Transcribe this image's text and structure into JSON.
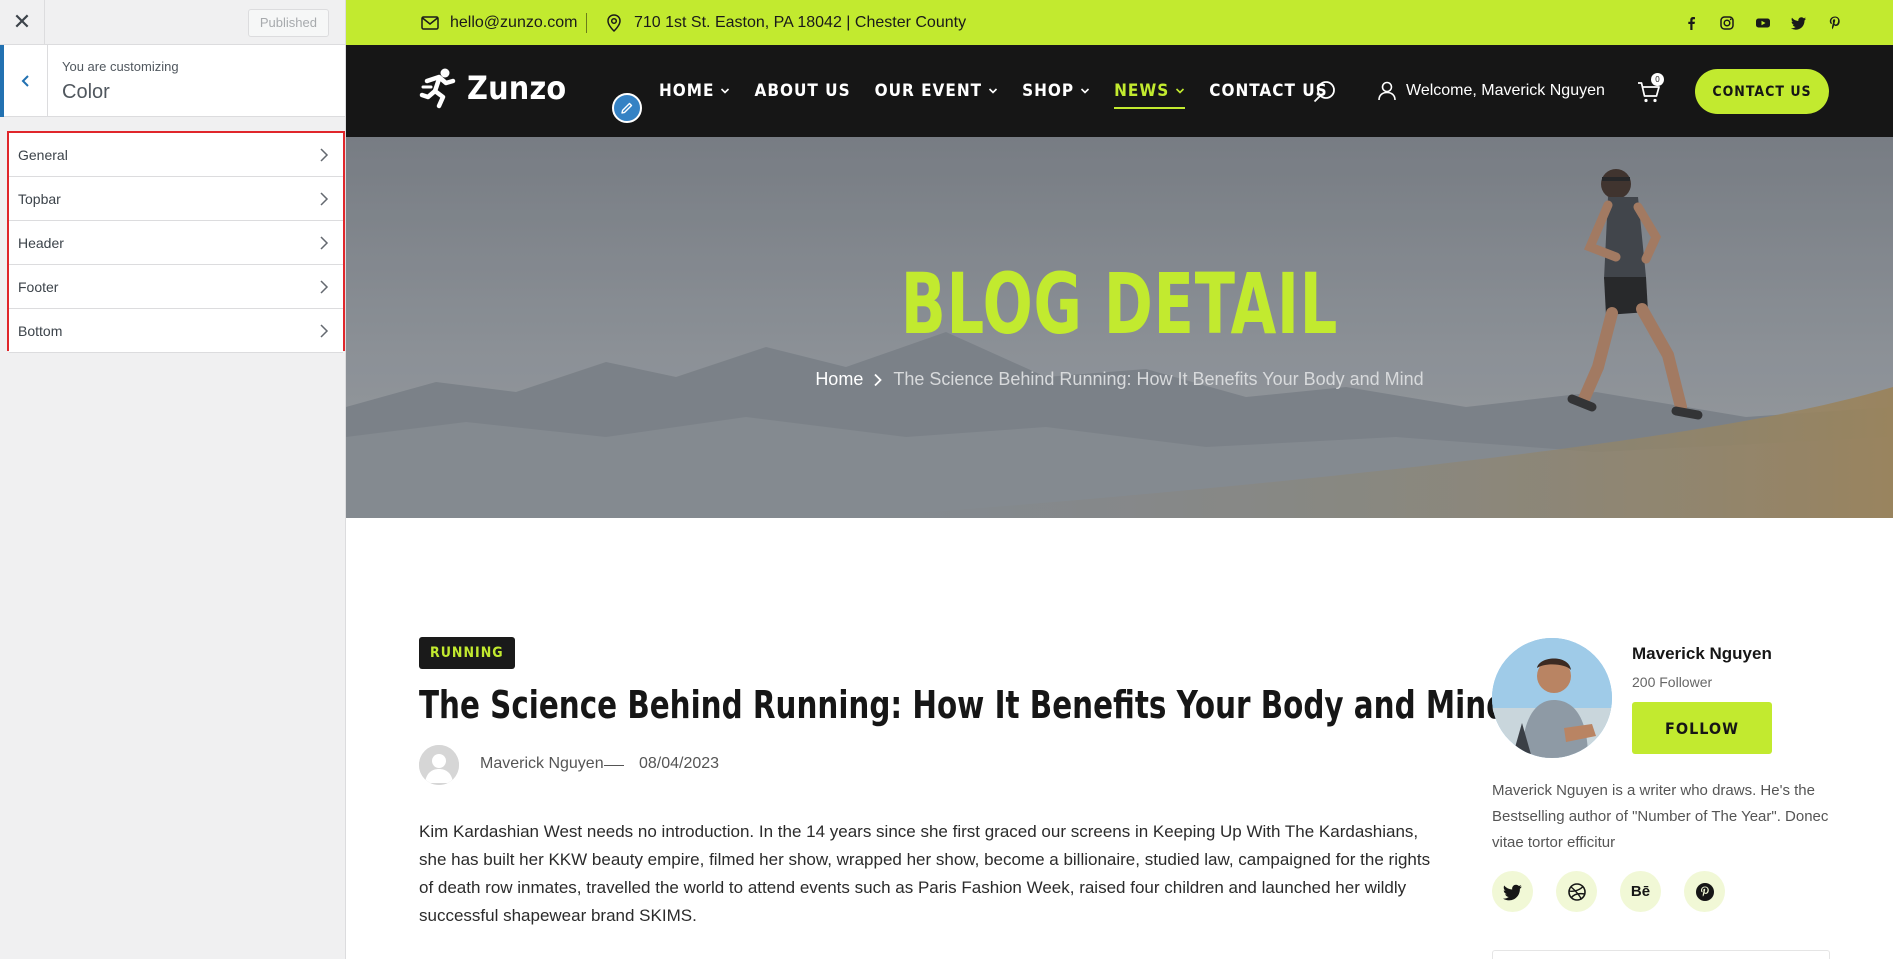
{
  "customizer": {
    "close_icon": "close-icon",
    "published_label": "Published",
    "customizing_label": "You are customizing",
    "section_title": "Color",
    "items": [
      {
        "label": "General"
      },
      {
        "label": "Topbar"
      },
      {
        "label": "Header"
      },
      {
        "label": "Footer"
      },
      {
        "label": "Bottom"
      }
    ]
  },
  "site": {
    "accent_color": "#c2ea2f",
    "topbar": {
      "email": "hello@zunzo.com",
      "address": "710 1st St. Easton, PA 18042 | Chester County",
      "socials": [
        "facebook-icon",
        "instagram-icon",
        "youtube-icon",
        "twitter-icon",
        "pinterest-icon"
      ]
    },
    "header": {
      "logo_text": "Zunzo",
      "menu": [
        {
          "label": "HOME",
          "dropdown": true,
          "active": false
        },
        {
          "label": "ABOUT US",
          "dropdown": false,
          "active": false
        },
        {
          "label": "OUR EVENT",
          "dropdown": true,
          "active": false
        },
        {
          "label": "SHOP",
          "dropdown": true,
          "active": false
        },
        {
          "label": "NEWS",
          "dropdown": true,
          "active": true
        },
        {
          "label": "CONTACT US",
          "dropdown": false,
          "active": false
        }
      ],
      "welcome": "Welcome, Maverick Nguyen",
      "cart_count": "0",
      "contact_button": "CONTACT US"
    },
    "hero": {
      "title": "BLOG DETAIL",
      "breadcrumb_home": "Home",
      "breadcrumb_current": "The Science Behind Running: How It Benefits Your Body and Mind"
    },
    "post": {
      "tag": "RUNNING",
      "title": "The Science Behind Running: How It Benefits Your Body and Mind",
      "author": "Maverick Nguyen",
      "date": "08/04/2023",
      "body": "Kim Kardashian West needs no introduction. In the 14 years since she first graced our screens in Keeping Up With The Kardashians, she has built her KKW beauty empire, filmed her show, wrapped her show, become a billionaire, studied law, campaigned for the rights of death row inmates, travelled the world to attend events such as Paris Fashion Week, raised four children and launched her wildly successful shapewear brand SKIMS."
    },
    "author_widget": {
      "name": "Maverick Nguyen",
      "followers": "200 Follower",
      "follow_button": "FOLLOW",
      "bio": "Maverick Nguyen is a writer who draws. He's the Bestselling author of \"Number of The Year\". Donec vitae tortor efficitur",
      "socials": [
        "twitter-icon",
        "dribbble-icon",
        "behance-icon",
        "pinterest-icon"
      ],
      "behance_text": "Bē"
    }
  }
}
